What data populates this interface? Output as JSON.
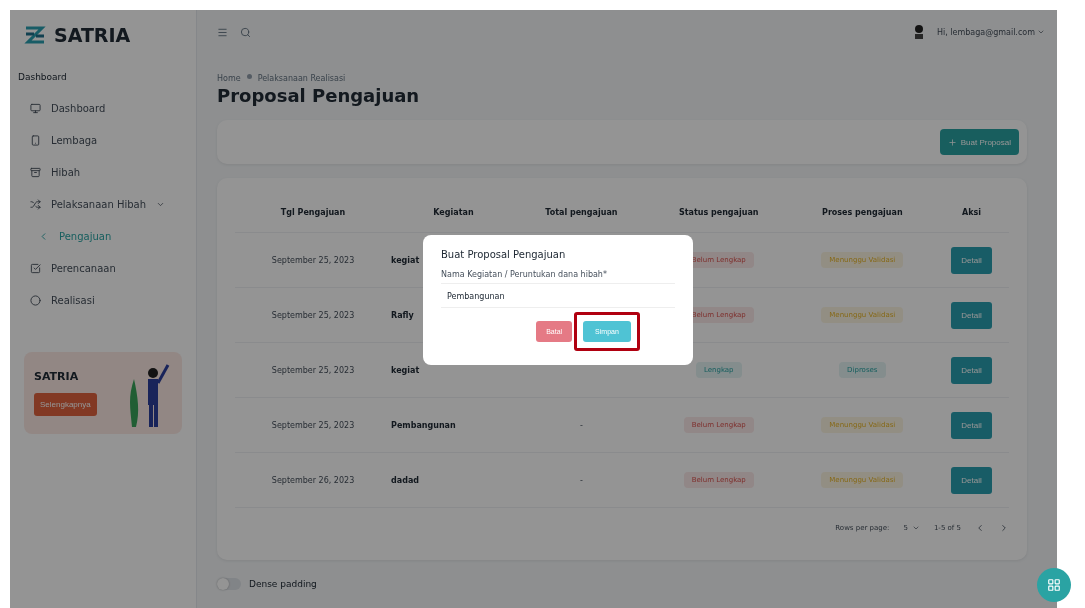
{
  "brand": {
    "name": "SATRIA"
  },
  "sidebar": {
    "section": "Dashboard",
    "items": [
      {
        "label": "Dashboard",
        "selected": false
      },
      {
        "label": "Lembaga",
        "selected": false
      },
      {
        "label": "Hibah",
        "selected": false
      },
      {
        "label": "Pelaksanaan Hibah",
        "selected": false,
        "expanded": true,
        "children": [
          {
            "label": "Pengajuan",
            "selected": true
          }
        ]
      },
      {
        "label": "Perencanaan",
        "selected": false
      },
      {
        "label": "Realisasi",
        "selected": false
      }
    ],
    "promo": {
      "title": "SATRIA",
      "button": "Selengkapnya"
    }
  },
  "header": {
    "user": "Hi, lembaga@gmail.com"
  },
  "breadcrumb": [
    "Home",
    "Pelaksanaan Realisasi"
  ],
  "page_title": "Proposal Pengajuan",
  "new_button": "Buat Proposal",
  "table": {
    "columns": [
      "Tgl Pengajuan",
      "Kegiatan",
      "Total pengajuan",
      "Status pengajuan",
      "Proses pengajuan",
      "Aksi"
    ],
    "rows": [
      {
        "date": "September 25, 2023",
        "activity": "kegiat",
        "status": {
          "label": "Belum Lengkap",
          "kind": "error"
        },
        "process": {
          "label": "Menunggu Validasi",
          "kind": "warning"
        },
        "action": "Detail"
      },
      {
        "date": "September 25, 2023",
        "activity": "Rafly",
        "status": {
          "label": "Belum Lengkap",
          "kind": "error"
        },
        "process": {
          "label": "Menunggu Validasi",
          "kind": "warning"
        },
        "action": "Detail"
      },
      {
        "date": "September 25, 2023",
        "activity": "kegiat",
        "status": {
          "label": "Lengkap",
          "kind": "success"
        },
        "process": {
          "label": "Diproses",
          "kind": "success"
        },
        "action": "Detail"
      },
      {
        "date": "September 25, 2023",
        "activity": "Pembangunan",
        "total": "-",
        "status": {
          "label": "Belum Lengkap",
          "kind": "error"
        },
        "process": {
          "label": "Menunggu Validasi",
          "kind": "warning"
        },
        "action": "Detail"
      },
      {
        "date": "September 26, 2023",
        "activity": "dadad",
        "total": "-",
        "status": {
          "label": "Belum Lengkap",
          "kind": "error"
        },
        "process": {
          "label": "Menunggu Validasi",
          "kind": "warning"
        },
        "action": "Detail"
      }
    ],
    "pagination": {
      "rows_label": "Rows per page:",
      "rows_value": "5",
      "range": "1-5 of 5"
    }
  },
  "dense_padding": {
    "label": "Dense padding",
    "on": false
  },
  "dialog": {
    "title": "Buat Proposal Pengajuan",
    "field_label": "Nama Kegiatan / Peruntukan dana hibah*",
    "value": "Pembangunan",
    "cancel": "Batal",
    "save": "Simpan",
    "save_highlighted": true
  }
}
